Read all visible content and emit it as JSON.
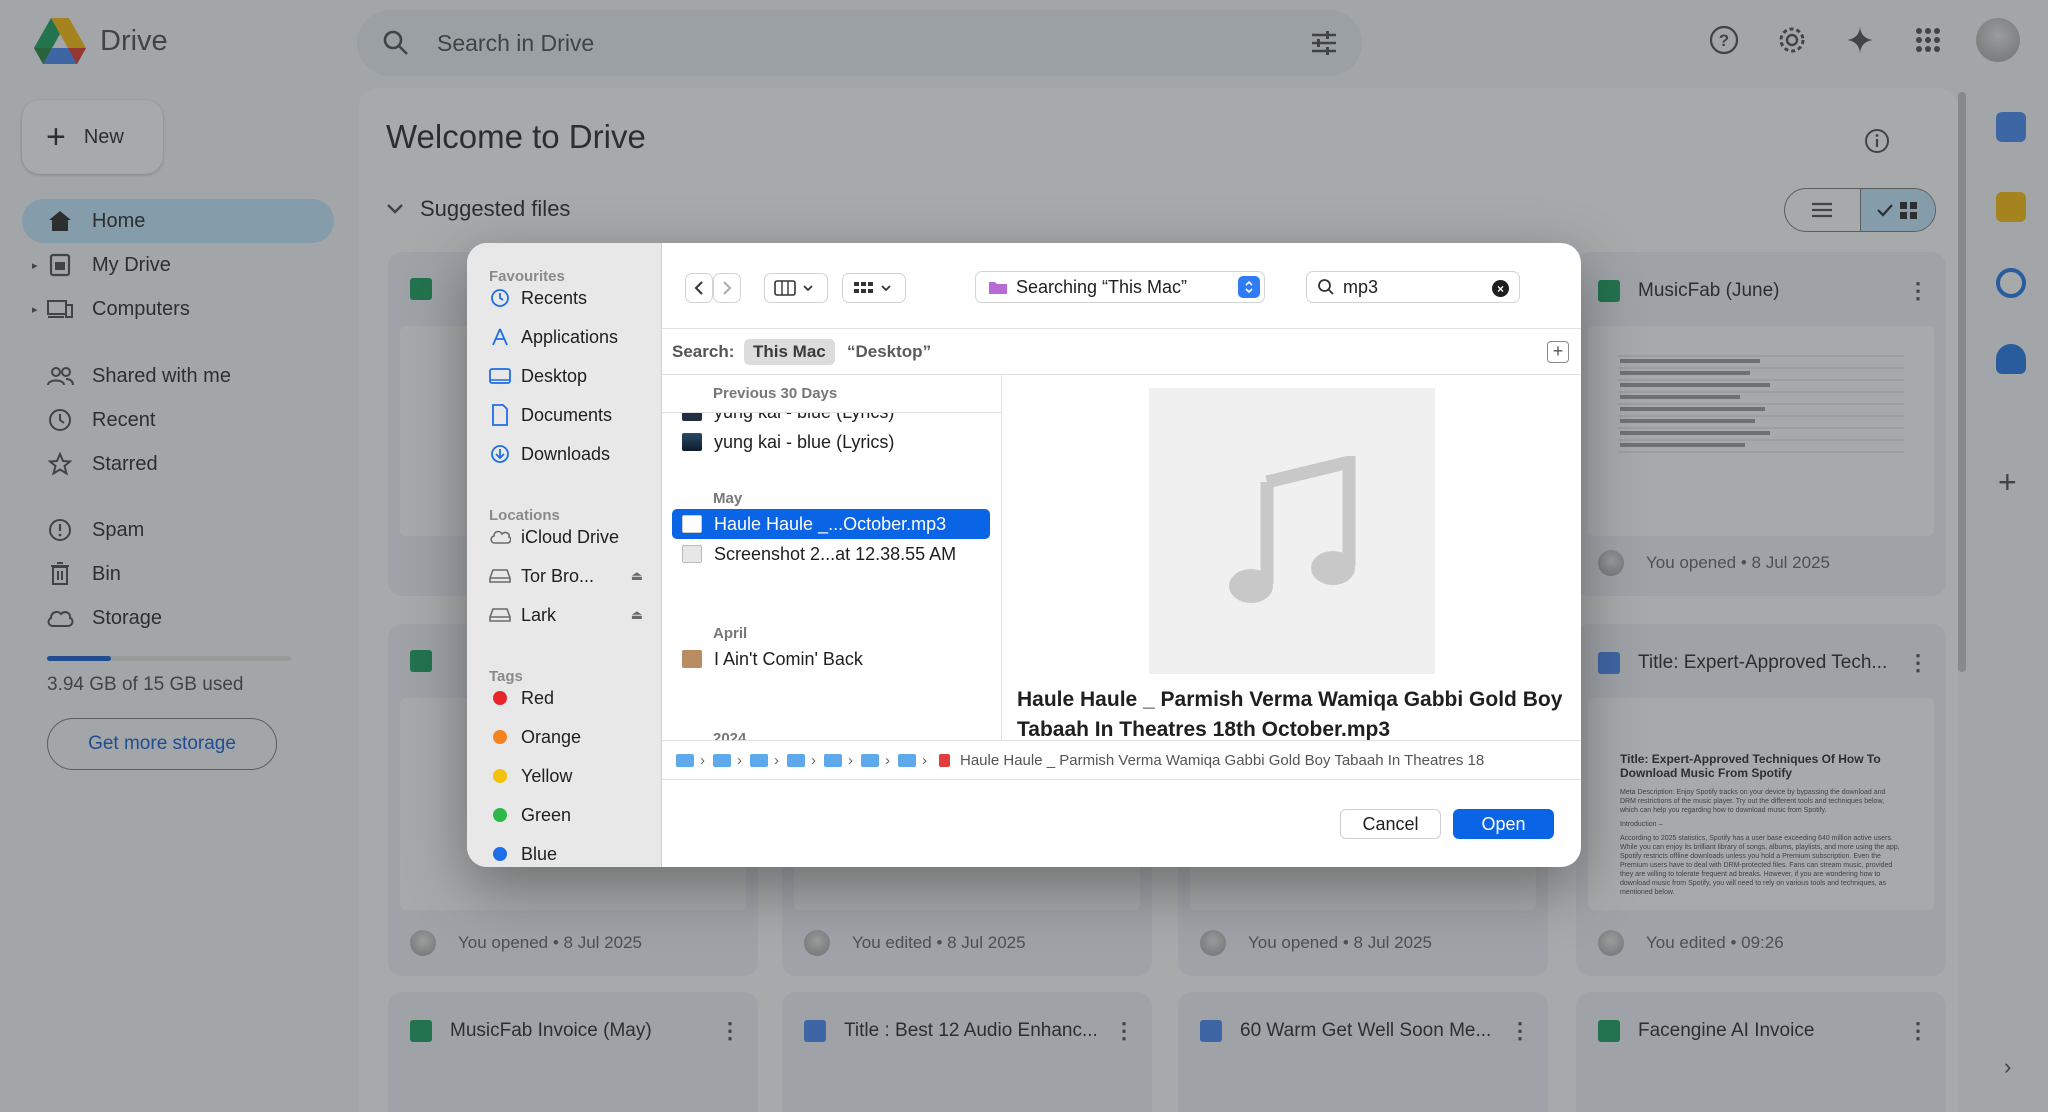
{
  "app": {
    "name": "Drive"
  },
  "search": {
    "placeholder": "Search in Drive"
  },
  "sidebar": {
    "new_label": "New",
    "items": [
      {
        "label": "Home",
        "icon": "home-icon"
      },
      {
        "label": "My Drive",
        "icon": "my-drive-icon"
      },
      {
        "label": "Computers",
        "icon": "computers-icon"
      },
      {
        "label": "Shared with me",
        "icon": "shared-icon"
      },
      {
        "label": "Recent",
        "icon": "clock-icon"
      },
      {
        "label": "Starred",
        "icon": "star-icon"
      },
      {
        "label": "Spam",
        "icon": "spam-icon"
      },
      {
        "label": "Bin",
        "icon": "bin-icon"
      },
      {
        "label": "Storage",
        "icon": "cloud-icon"
      }
    ],
    "storage_text": "3.94 GB of 15 GB used",
    "storage_used_fraction": 0.26,
    "get_storage_label": "Get more storage"
  },
  "main": {
    "welcome": "Welcome to Drive",
    "suggested": "Suggested files",
    "cards": [
      {
        "title": "MusicFab (June)",
        "footer": "You opened • 8 Jul 2025",
        "type": "sheet"
      },
      {
        "title": "Title: Expert-Approved Tech...",
        "footer": "You edited • 09:26",
        "type": "doc"
      },
      {
        "title": "",
        "footer": "You opened • 8 Jul 2025",
        "type": "sheet"
      },
      {
        "title": "",
        "footer": "You edited • 8 Jul 2025",
        "type": "doc"
      },
      {
        "title": "",
        "footer": "You opened • 8 Jul 2025",
        "type": "doc"
      },
      {
        "title": "MusicFab Invoice (May)",
        "type": "sheet"
      },
      {
        "title": "Title : Best 12 Audio Enhanc...",
        "type": "doc"
      },
      {
        "title": "60 Warm Get Well Soon Me...",
        "type": "doc"
      },
      {
        "title": "Facengine AI Invoice",
        "type": "sheet"
      }
    ],
    "doc_preview": {
      "heading": "Title: Expert-Approved Techniques Of How To Download Music From Spotify",
      "meta": "Meta Description: Enjoy Spotify tracks on your device by bypassing the download and DRM restrictions of the music player. Try out the different tools and techniques below, which can help you regarding how to download music from Spotify.",
      "intro": "Introduction –",
      "body": "According to 2025 statistics, Spotify has a user base exceeding 640 million active users. While you can enjoy its brilliant library of songs, albums, playlists, and more using the app, Spotify restricts offline downloads unless you hold a Premium subscription. Even the Premium users have to deal with DRM-protected files. Fans can stream music, provided they are willing to tolerate frequent ad breaks. However, if you are wondering how to download music from Spotify, you will need to rely on various tools and techniques, as mentioned below."
    }
  },
  "dialog": {
    "favourites_title": "Favourites",
    "favourites": [
      "Recents",
      "Applications",
      "Desktop",
      "Documents",
      "Downloads"
    ],
    "locations_title": "Locations",
    "locations": [
      "iCloud Drive",
      "Tor Bro...",
      "Lark"
    ],
    "tags_title": "Tags",
    "tags": [
      {
        "label": "Red",
        "color": "#e8252a"
      },
      {
        "label": "Orange",
        "color": "#f5841f"
      },
      {
        "label": "Yellow",
        "color": "#f4c20d"
      },
      {
        "label": "Green",
        "color": "#2fb84a"
      },
      {
        "label": "Blue",
        "color": "#1e6ee8"
      }
    ],
    "location_popup": "Searching “This Mac”",
    "search_value": "mp3",
    "scope_label": "Search:",
    "scope_this_mac": "This Mac",
    "scope_desktop": "“Desktop”",
    "groups": {
      "previous30": "Previous 30 Days",
      "may": "May",
      "april": "April",
      "year": "2024"
    },
    "files": [
      {
        "name": "yung kai - blue (Lyrics)"
      },
      {
        "name": "yung kai - blue (Lyrics)"
      },
      {
        "name": "Haule Haule _...October.mp3",
        "selected": true
      },
      {
        "name": "Screenshot 2...at 12.38.55 AM"
      },
      {
        "name": "I Ain't Comin' Back"
      }
    ],
    "preview_name": "Haule Haule _ Parmish Verma  Wamiqa Gabbi  Gold Boy Tabaah In Theatres 18th October.mp3",
    "path_file": "Haule Haule _ Parmish Verma  Wamiqa Gabbi  Gold Boy  Tabaah In Theatres 18",
    "cancel_label": "Cancel",
    "open_label": "Open"
  },
  "colors": {
    "accent": "#0a64e6",
    "drive_active": "#c2e7ff"
  }
}
